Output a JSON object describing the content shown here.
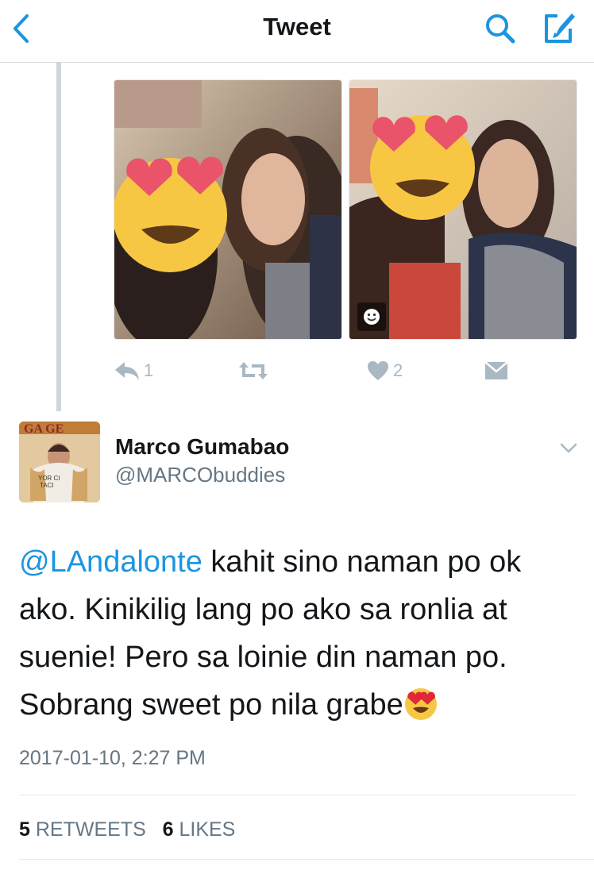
{
  "navbar": {
    "title": "Tweet",
    "back_icon": "chevron-left-icon",
    "search_icon": "search-icon",
    "compose_icon": "compose-icon"
  },
  "previous_tweet": {
    "photo_count": 2,
    "actions": {
      "reply_count": "1",
      "retweet_count": "",
      "like_count": "2"
    }
  },
  "tweet": {
    "author_name": "Marco Gumabao",
    "author_handle": "@MARCObuddies",
    "mention": "@LAndalonte",
    "body": " kahit sino naman po ok ako. Kinikilig lang po ako sa ronlia at suenie! Pero sa loinie din naman po. Sobrang sweet po nila grabe",
    "timestamp": "2017-01-10, 2:27 PM",
    "retweets_count": "5",
    "retweets_label": "RETWEETS",
    "likes_count": "6",
    "likes_label": "LIKES"
  },
  "colors": {
    "accent": "#1b95e0",
    "muted": "#657786",
    "icon_gray": "#aab8c2",
    "divider": "#e1e8ed"
  }
}
